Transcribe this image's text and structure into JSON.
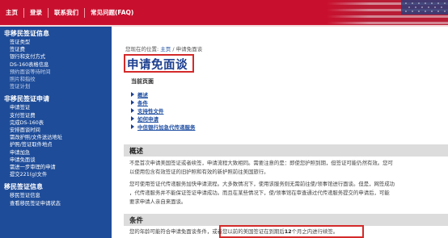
{
  "nav": {
    "items": [
      "主页",
      "登录",
      "联系我们",
      "常见问题(FAQ)"
    ]
  },
  "sidebar": {
    "sections": [
      {
        "title": "非移民签证信息",
        "items": [
          "签证类型",
          "签证费",
          "银行和支付方式",
          "DS-160表格信息",
          "预约面谈等待时间",
          "照片和指纹",
          "签证计划"
        ]
      },
      {
        "title": "非移民签证申请",
        "items": [
          "申请签证",
          "支付签证费",
          "完成DS-160表",
          "安排面谈时间",
          "需改护照/文件送达地址",
          "护照/签证取件地点",
          "申请加急",
          "申请免面谈",
          "需进一步审理的申请",
          "提交221(g)文件"
        ]
      },
      {
        "title": "移民签证信息",
        "items": [
          "移民签证信息",
          "查看移民签证申请状态"
        ]
      }
    ]
  },
  "main": {
    "breadcrumb_prefix": "您现在的位置:",
    "breadcrumb_home": "主页",
    "breadcrumb_sep": "/",
    "breadcrumb_current": "申请免面谈",
    "title": "申请免面谈",
    "current_page_label": "当前页面",
    "toc": [
      "概述",
      "条件",
      "支持性文件",
      "如何申请",
      "中信银行加急代传递服务"
    ],
    "overview": {
      "heading": "概述",
      "p1_line1": "不是首次申请美国签证或者续签，申请流程大致相同。需要注意的是：即使您护照到期，但签证可能仍然有效。您可",
      "p1_line2": "以使用包含有效签证的旧护照和有效的新护照前往美国旅行。",
      "p2_line1": "您可使用签证代传递服务加快申请流程。大多数情况下，使用该服务则无需前往使/领事馆进行面谈。但是，网签成功",
      "p2_line2": "，代传递服务并不能保证签证申请成功。而且在某些情况下，使/领事馆在审查通过代传递服务提交的申请后，可能",
      "p2_line3": "要求申请人亲自来面谈。"
    },
    "conditions": {
      "heading": "条件",
      "text_before": "您的年龄可能符合申请免面谈条件，",
      "text_highlight_a": "或者您以前的美国签证在到期后",
      "text_highlight_b": "12",
      "text_highlight_c": "个月之内进行续签。"
    }
  },
  "colors": {
    "nav_red": "#c8102e",
    "sidebar_blue": "#1e4c99",
    "title_blue": "#1d3f8f",
    "annotation_red": "#d42a2a",
    "section_gray": "#dcdcdc"
  }
}
